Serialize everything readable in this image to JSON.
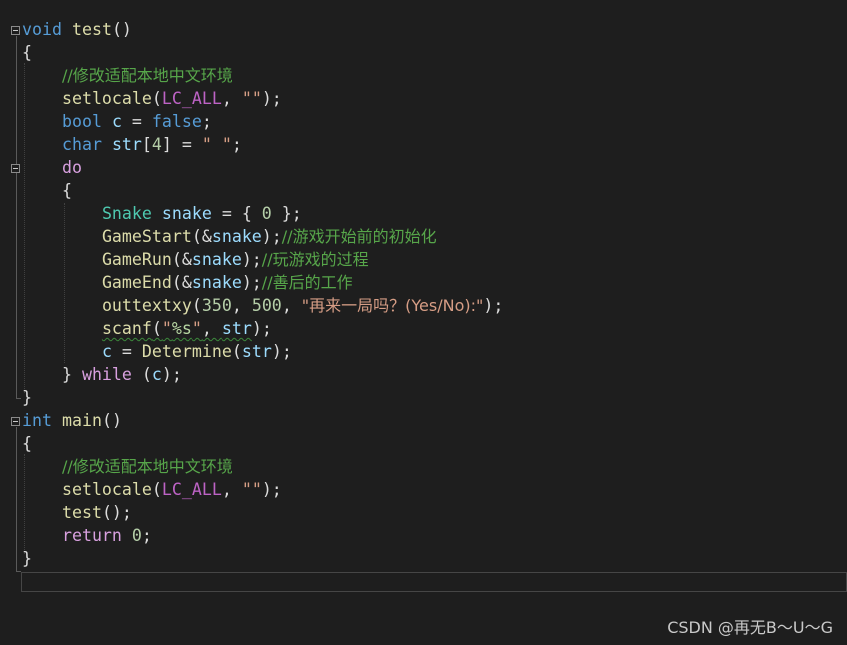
{
  "editor": {
    "lines": [
      [
        {
          "t": "void",
          "c": "kw"
        },
        {
          "t": " "
        },
        {
          "t": "test",
          "c": "fn"
        },
        {
          "t": "()"
        }
      ],
      [
        {
          "t": "{"
        }
      ],
      [
        {
          "t": "    "
        },
        {
          "t": "//修改适配本地中文环境",
          "c": "cmt"
        }
      ],
      [
        {
          "t": "    "
        },
        {
          "t": "setlocale",
          "c": "fn"
        },
        {
          "t": "("
        },
        {
          "t": "LC_ALL",
          "c": "mac"
        },
        {
          "t": ", "
        },
        {
          "t": "\"\"",
          "c": "str"
        },
        {
          "t": ");"
        }
      ],
      [
        {
          "t": "    "
        },
        {
          "t": "bool",
          "c": "kw"
        },
        {
          "t": " "
        },
        {
          "t": "c",
          "c": "var"
        },
        {
          "t": " = "
        },
        {
          "t": "false",
          "c": "kw"
        },
        {
          "t": ";"
        }
      ],
      [
        {
          "t": "    "
        },
        {
          "t": "char",
          "c": "kw"
        },
        {
          "t": " "
        },
        {
          "t": "str",
          "c": "var"
        },
        {
          "t": "["
        },
        {
          "t": "4",
          "c": "num"
        },
        {
          "t": "] = "
        },
        {
          "t": "\" \"",
          "c": "str"
        },
        {
          "t": ";"
        }
      ],
      [
        {
          "t": "    "
        },
        {
          "t": "do",
          "c": "ctl"
        }
      ],
      [
        {
          "t": "    {"
        }
      ],
      [
        {
          "t": "        "
        },
        {
          "t": "Snake",
          "c": "type"
        },
        {
          "t": " "
        },
        {
          "t": "snake",
          "c": "var"
        },
        {
          "t": " = { "
        },
        {
          "t": "0",
          "c": "num"
        },
        {
          "t": " };"
        }
      ],
      [
        {
          "t": "        "
        },
        {
          "t": "GameStart",
          "c": "fn"
        },
        {
          "t": "(&"
        },
        {
          "t": "snake",
          "c": "var"
        },
        {
          "t": ");"
        },
        {
          "t": "//游戏开始前的初始化",
          "c": "cmt"
        }
      ],
      [
        {
          "t": "        "
        },
        {
          "t": "GameRun",
          "c": "fn"
        },
        {
          "t": "(&"
        },
        {
          "t": "snake",
          "c": "var"
        },
        {
          "t": ");"
        },
        {
          "t": "//玩游戏的过程",
          "c": "cmt"
        }
      ],
      [
        {
          "t": "        "
        },
        {
          "t": "GameEnd",
          "c": "fn"
        },
        {
          "t": "(&"
        },
        {
          "t": "snake",
          "c": "var"
        },
        {
          "t": ");"
        },
        {
          "t": "//善后的工作",
          "c": "cmt"
        }
      ],
      [
        {
          "t": "        "
        },
        {
          "t": "outtextxy",
          "c": "fn"
        },
        {
          "t": "("
        },
        {
          "t": "350",
          "c": "num"
        },
        {
          "t": ", "
        },
        {
          "t": "500",
          "c": "num"
        },
        {
          "t": ", "
        },
        {
          "t": "\"再来一局吗？(Yes/No):\"",
          "c": "str"
        },
        {
          "t": ");"
        }
      ],
      [
        {
          "t": "        "
        },
        {
          "t": "scanf",
          "c": "fn",
          "sq": true
        },
        {
          "t": "(",
          "sq": true
        },
        {
          "t": "\"",
          "c": "str",
          "sq": true
        },
        {
          "t": "%s",
          "c": "fmt",
          "sq": true
        },
        {
          "t": "\"",
          "c": "str",
          "sq": true
        },
        {
          "t": ", ",
          "sq": true
        },
        {
          "t": "str",
          "c": "var",
          "sq": true
        },
        {
          "t": ");"
        }
      ],
      [
        {
          "t": "        "
        },
        {
          "t": "c",
          "c": "var"
        },
        {
          "t": " = "
        },
        {
          "t": "Determine",
          "c": "fn"
        },
        {
          "t": "("
        },
        {
          "t": "str",
          "c": "var"
        },
        {
          "t": ");"
        }
      ],
      [
        {
          "t": "    } "
        },
        {
          "t": "while",
          "c": "ctl"
        },
        {
          "t": " ("
        },
        {
          "t": "c",
          "c": "var"
        },
        {
          "t": ");"
        }
      ],
      [
        {
          "t": "}"
        }
      ],
      [
        {
          "t": "int",
          "c": "kw"
        },
        {
          "t": " "
        },
        {
          "t": "main",
          "c": "fn"
        },
        {
          "t": "()"
        }
      ],
      [
        {
          "t": "{"
        }
      ],
      [
        {
          "t": "    "
        },
        {
          "t": "//修改适配本地中文环境",
          "c": "cmt"
        }
      ],
      [
        {
          "t": "    "
        },
        {
          "t": "setlocale",
          "c": "fn"
        },
        {
          "t": "("
        },
        {
          "t": "LC_ALL",
          "c": "mac"
        },
        {
          "t": ", "
        },
        {
          "t": "\"\"",
          "c": "str"
        },
        {
          "t": ");"
        }
      ],
      [
        {
          "t": "    "
        },
        {
          "t": "test",
          "c": "fn"
        },
        {
          "t": "();"
        }
      ],
      [
        {
          "t": "    "
        },
        {
          "t": "return",
          "c": "ctl"
        },
        {
          "t": " "
        },
        {
          "t": "0",
          "c": "num"
        },
        {
          "t": ";"
        }
      ],
      [
        {
          "t": "}"
        }
      ]
    ]
  },
  "watermark": "CSDN @再无B～U～G",
  "colors": {
    "background": "#1e1e1e",
    "keyword": "#569cd6",
    "control": "#d8a0df",
    "type": "#4ec9b0",
    "function": "#dcdcaa",
    "variable": "#9cdcfe",
    "macro": "#bd63c5",
    "string": "#d69d85",
    "number": "#b5cea8",
    "comment": "#57a64a"
  },
  "icons": [
    "fold-collapse-icon"
  ]
}
